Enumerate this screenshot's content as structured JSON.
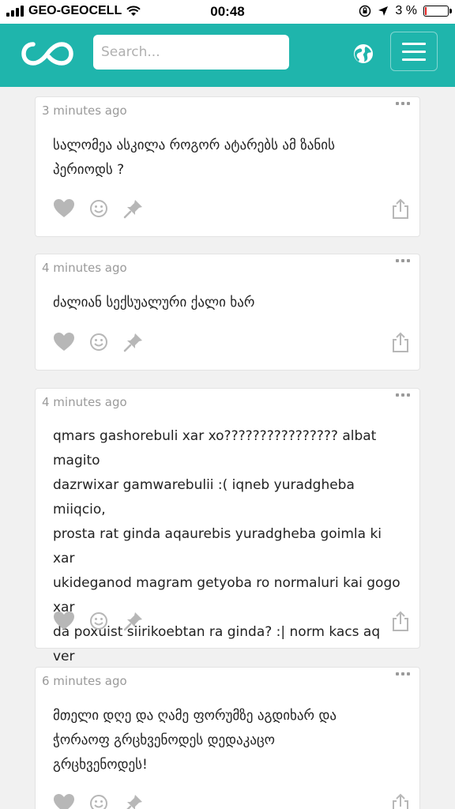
{
  "status_bar": {
    "carrier": "GEO-GEOCELL",
    "time": "00:48",
    "battery_pct": "3 %",
    "battery_level": 0.03
  },
  "header": {
    "logo_icon": "infinity-logo-icon",
    "search_placeholder": "Search...",
    "globe_icon": "globe-icon",
    "menu_icon": "hamburger-menu-icon",
    "brand_color": "#1fb5ac"
  },
  "posts": [
    {
      "time": "3 minutes ago",
      "text": "სალომეა ასკილა როგორ ატარებს ამ ზანის\nპერიოდს ?"
    },
    {
      "time": "4 minutes ago",
      "text": "ძალიან სექსუალური ქალი ხარ"
    },
    {
      "time": "4 minutes ago",
      "text": "qmars gashorebuli xar xo???????????????? albat magito\ndazrwixar gamwarebulii :( iqneb yuradgheba miiqcio,\nprosta rat ginda aqaurebis yuradgheba goimla ki xar\nukideganod magram getyoba ro normaluri kai gogo xar\nda poxuist siirikoebtan ra ginda? :| norm kacs aq ver\naagdeb ro dapiqrde mixvdebi ro kai da swori ragac\ngitxari aba shen ici"
    },
    {
      "time": "6 minutes ago",
      "text": "მთელი დღე და ღამე ფორუმზე აგდიხარ და\nჭორაოფ გრცხვენოდეს დედაკაცო\nგრცხვენოდეს!"
    }
  ],
  "post_actions": {
    "like_icon": "heart-icon",
    "react_icon": "smiley-icon",
    "pin_icon": "pushpin-icon",
    "share_icon": "share-icon",
    "menu_icon": "more-dots-icon"
  }
}
